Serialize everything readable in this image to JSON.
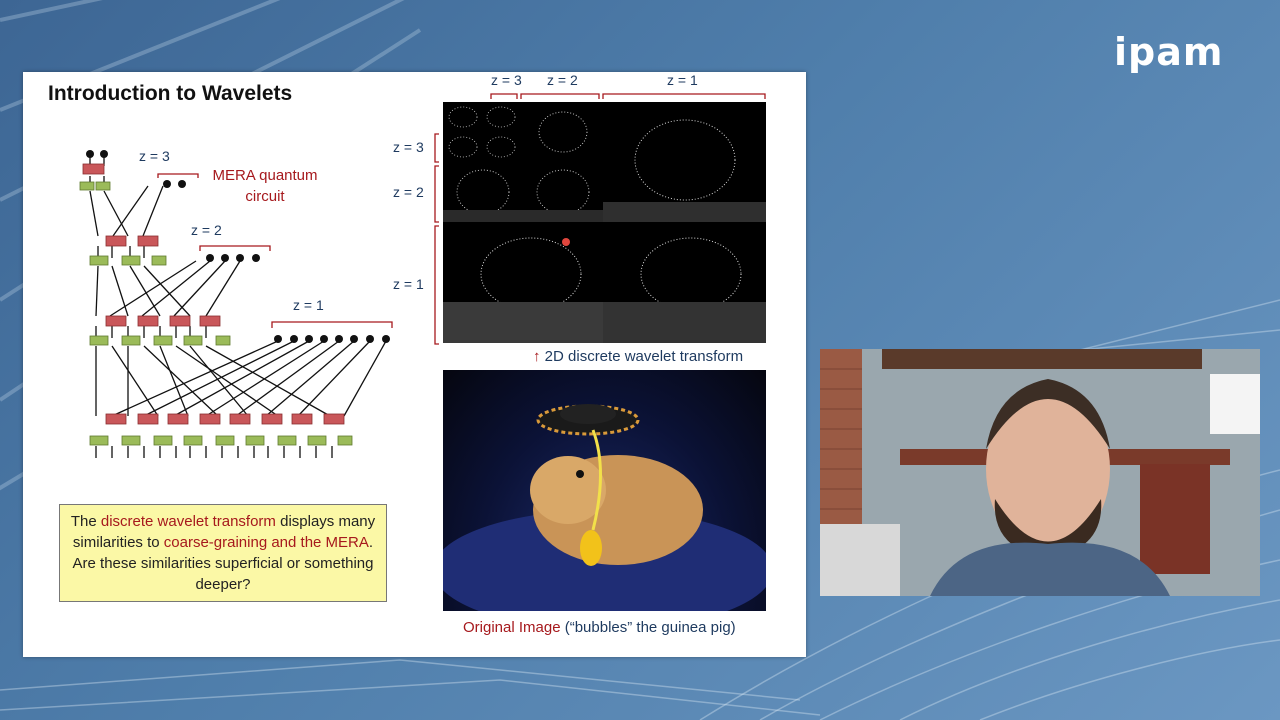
{
  "logo": {
    "text": "ipam"
  },
  "slide": {
    "title": "Introduction to Wavelets",
    "mera_label_line1": "MERA quantum",
    "mera_label_line2": "circuit",
    "circuit_z_labels": [
      "z = 3",
      "z = 2",
      "z = 1"
    ],
    "callout": {
      "t1": "The ",
      "r1": "discrete wavelet transform",
      "t2": " displays many similarities to ",
      "r2": "coarse-graining and the MERA",
      "t3": ".  Are these similarities superficial or something deeper?"
    },
    "wavelet_top_labels": [
      "z = 3",
      "z = 2",
      "z = 1"
    ],
    "wavelet_side_labels": [
      "z = 3",
      "z = 2",
      "z = 1"
    ],
    "dwt_arrow": "↑",
    "dwt_caption": "2D discrete wavelet transform",
    "photo_caption_red": "Original Image",
    "photo_caption_rest": " (“bubbles” the guinea pig)"
  },
  "colors": {
    "accent_red": "#a6191d",
    "gate_red": "#c9575a",
    "gate_green": "#9bbb59",
    "callout_bg": "#fbf8a6",
    "caption_blue": "#1e3a5f"
  },
  "webcam": {
    "description_icon": "presenter-video-icon"
  }
}
